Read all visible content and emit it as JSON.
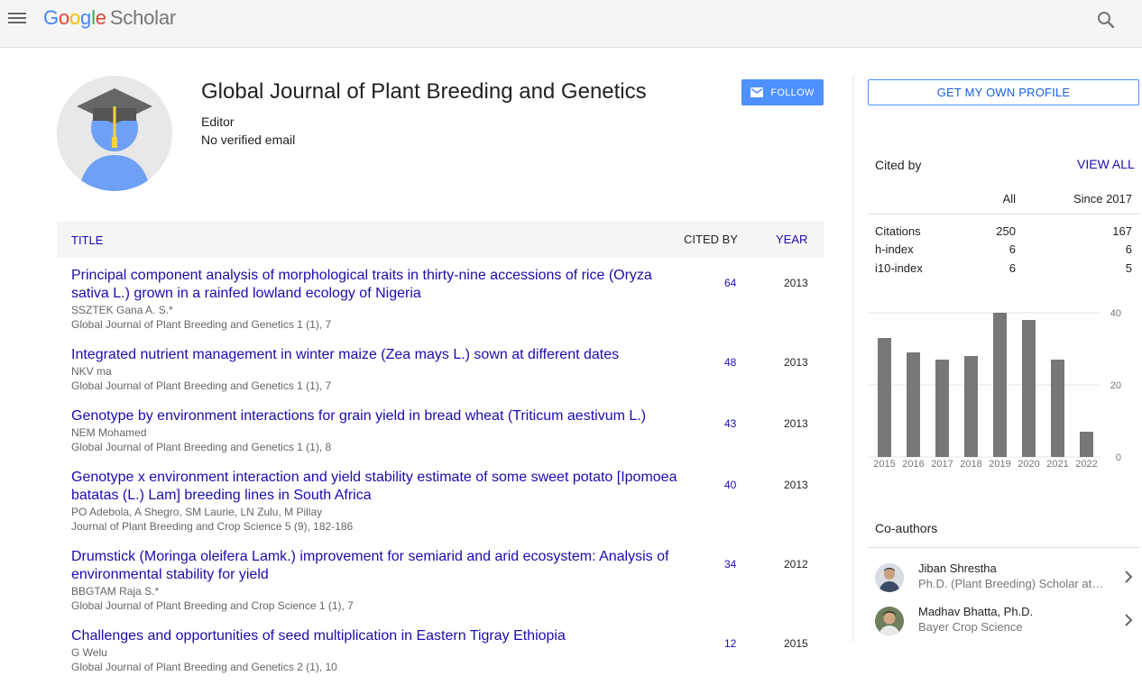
{
  "header": {
    "logo_letters": [
      "G",
      "o",
      "o",
      "g",
      "l",
      "e"
    ],
    "logo_colors": [
      "#4285f4",
      "#ea4335",
      "#fbbc05",
      "#4285f4",
      "#34a853",
      "#ea4335"
    ],
    "logo_suffix": "Scholar"
  },
  "profile": {
    "name": "Global Journal of Plant Breeding and Genetics",
    "affiliation": "Editor",
    "email": "No verified email",
    "follow_label": "FOLLOW"
  },
  "table": {
    "title_header": "TITLE",
    "cited_header": "CITED BY",
    "year_header": "YEAR",
    "rows": [
      {
        "title": "Principal component analysis of morphological traits in thirty-nine accessions of rice (Oryza sativa L.) grown in a rainfed lowland ecology of Nigeria",
        "authors": "SSZTEK Gana A. S.*",
        "venue": "Global Journal of Plant Breeding and Genetics 1 (1), 7",
        "cited": "64",
        "year": "2013"
      },
      {
        "title": "Integrated nutrient management in winter maize (Zea mays L.) sown at different dates",
        "authors": "NKV ma",
        "venue": "Global Journal of Plant Breeding and Genetics 1 (1), 7",
        "cited": "48",
        "year": "2013"
      },
      {
        "title": "Genotype by environment interactions for grain yield in bread wheat (Triticum aestivum L.)",
        "authors": "NEM Mohamed",
        "venue": "Global Journal of Plant Breeding and Genetics 1 (1), 8",
        "cited": "43",
        "year": "2013"
      },
      {
        "title": "Genotype x environment interaction and yield stability estimate of some sweet potato [Ipomoea batatas (L.) Lam] breeding lines in South Africa",
        "authors": "PO Adebola, A Shegro, SM Laurie, LN Zulu, M Pillay",
        "venue": "Journal of Plant Breeding and Crop Science 5 (9), 182-186",
        "cited": "40",
        "year": "2013"
      },
      {
        "title": "Drumstick (Moringa oleifera Lamk.) improvement for semiarid and arid ecosystem: Analysis of environmental stability for yield",
        "authors": "BBGTAM Raja S.*",
        "venue": "Global Journal of Plant Breeding and Crop Science 1 (1), 7",
        "cited": "34",
        "year": "2012"
      },
      {
        "title": "Challenges and opportunities of seed multiplication in Eastern Tigray Ethiopia",
        "authors": "G Welu",
        "venue": "Global Journal of Plant Breeding and Genetics 2 (1), 10",
        "cited": "12",
        "year": "2015"
      }
    ]
  },
  "sidebar": {
    "own_profile_label": "GET MY OWN PROFILE",
    "cited_by_label": "Cited by",
    "view_all_label": "VIEW ALL",
    "col_all": "All",
    "col_since": "Since 2017",
    "metrics": [
      {
        "label": "Citations",
        "all": "250",
        "since": "167"
      },
      {
        "label": "h-index",
        "all": "6",
        "since": "6"
      },
      {
        "label": "i10-index",
        "all": "6",
        "since": "5"
      }
    ],
    "coauthors_label": "Co-authors",
    "coauthors": [
      {
        "name": "Jiban Shrestha",
        "affiliation": "Ph.D. (Plant Breeding) Scholar at Chinese Academy of Agricultural Sciences"
      },
      {
        "name": "Madhav Bhatta, Ph.D.",
        "affiliation": "Bayer Crop Science"
      }
    ]
  },
  "chart_data": {
    "type": "bar",
    "categories": [
      "2015",
      "2016",
      "2017",
      "2018",
      "2019",
      "2020",
      "2021",
      "2022"
    ],
    "values": [
      33,
      29,
      27,
      28,
      40,
      38,
      27,
      7
    ],
    "yticks": [
      0,
      20,
      40
    ],
    "ylim": [
      0,
      40
    ],
    "bar_color": "#777777",
    "grid": true
  }
}
